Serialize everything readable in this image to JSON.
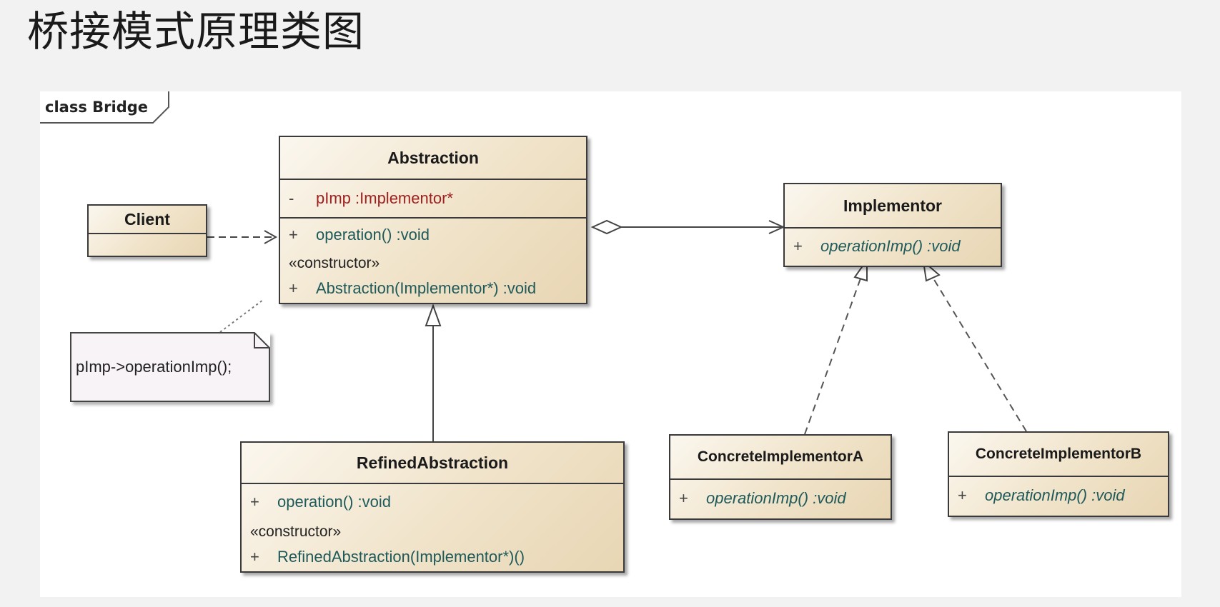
{
  "page": {
    "title": "桥接模式原理类图"
  },
  "diagram": {
    "frame_label": "class Bridge",
    "note": {
      "text": "pImp->operationImp();"
    },
    "classes": {
      "client": {
        "name": "Client"
      },
      "abstraction": {
        "name": "Abstraction",
        "attribute": {
          "visibility": "-",
          "text": "pImp  :Implementor*"
        },
        "operation": {
          "visibility": "+",
          "text": "operation()  :void"
        },
        "stereotype": "«constructor»",
        "constructor": {
          "visibility": "+",
          "text": "Abstraction(Implementor*)  :void"
        }
      },
      "implementor": {
        "name": "Implementor",
        "operation": {
          "visibility": "+",
          "text": "operationImp()  :void"
        }
      },
      "refined_abstraction": {
        "name": "RefinedAbstraction",
        "operation": {
          "visibility": "+",
          "text": "operation()  :void"
        },
        "stereotype": "«constructor»",
        "constructor": {
          "visibility": "+",
          "text": "RefinedAbstraction(Implementor*)()"
        }
      },
      "concrete_a": {
        "name": "ConcreteImplementorA",
        "operation": {
          "visibility": "+",
          "text": "operationImp()  :void"
        }
      },
      "concrete_b": {
        "name": "ConcreteImplementorB",
        "operation": {
          "visibility": "+",
          "text": "operationImp()  :void"
        }
      }
    },
    "colors": {
      "attribute": "#a02020",
      "operation": "#1e5a5a",
      "class_fill": "#f0e3c9",
      "border": "#3a3a3a"
    }
  }
}
